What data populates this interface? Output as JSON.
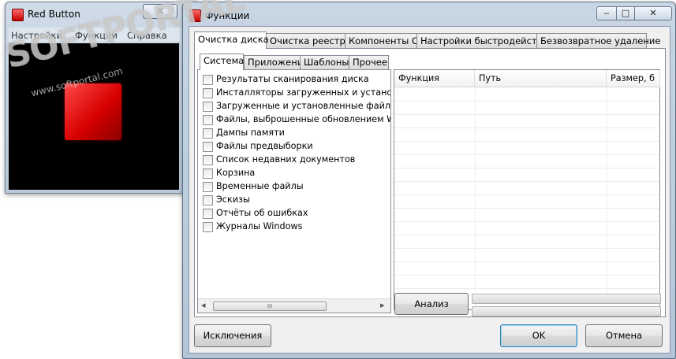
{
  "small_window": {
    "title": "Red Button",
    "close_glyph": "✕",
    "menu": [
      "Настройки",
      "Функции",
      "Справка"
    ]
  },
  "main_window": {
    "title": "Функции",
    "minimize_glyph": "‒",
    "maximize_glyph": "□",
    "close_glyph": "✕",
    "tabs": [
      "Очистка диска",
      "Очистка реестра",
      "Компоненты ОС",
      "Настройки быстродействия",
      "Безвозвратное удаление"
    ],
    "subtabs": [
      "Система",
      "Приложения",
      "Шаблоны",
      "Прочее"
    ],
    "items": [
      "Результаты сканирования диска",
      "Инсталляторы загруженных и установленн",
      "Загруженные и установленные файлы прог",
      "Файлы, выброшенные обновлением Window",
      "Дампы памяти",
      "Файлы предвыборки",
      "Список недавних документов",
      "Корзина",
      "Временные файлы",
      "Эскизы",
      "Отчёты об ошибках",
      "Журналы Windows"
    ],
    "scroll": {
      "left": "◂",
      "thumb": "III",
      "right": "▸"
    },
    "columns": [
      "Функция",
      "Путь",
      "Размер, б"
    ],
    "analyze_button": "Анализ",
    "exclusions_button": "Исключения",
    "ok_button": "OK",
    "cancel_button": "Отмена"
  },
  "watermark": {
    "text": "SOFTPORTAL",
    "sub": "www.softportal.com"
  }
}
